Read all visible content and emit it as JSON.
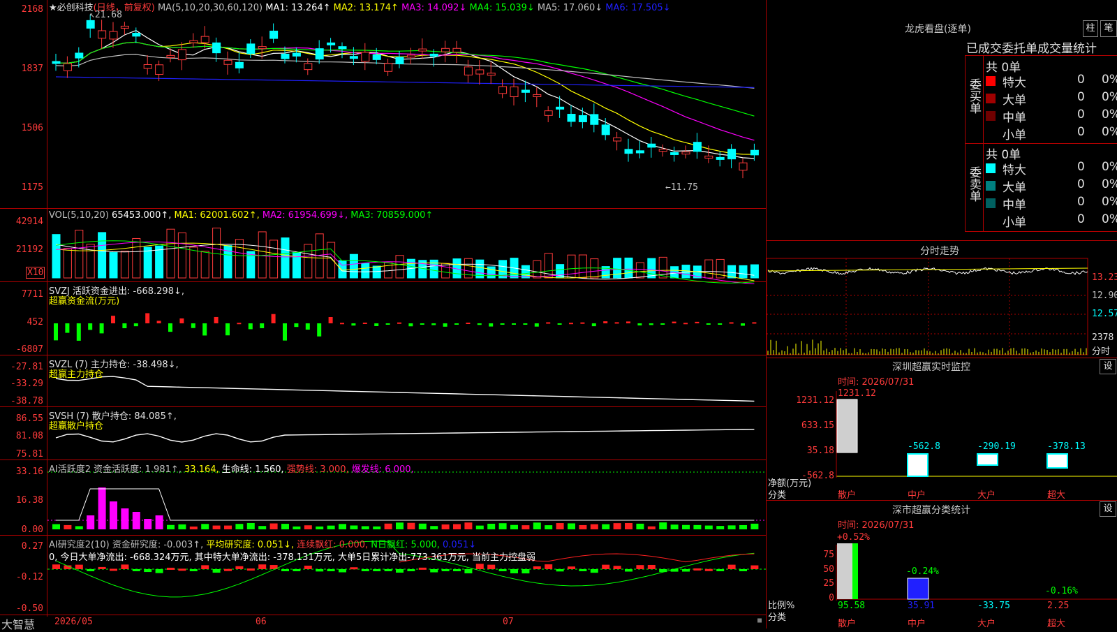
{
  "stock": {
    "title": "★必创科技",
    "period": "(日线，前复权)"
  },
  "kline": {
    "ma_header": [
      {
        "label": "MA(5,10,20,30,60,120)",
        "color": "#c0c0c0"
      },
      {
        "label": "MA1: 13.264↑",
        "color": "#ffffff"
      },
      {
        "label": "MA2: 13.174↑",
        "color": "#ffff00"
      },
      {
        "label": "MA3: 14.092↓",
        "color": "#ff00ff"
      },
      {
        "label": "MA4: 15.039↓",
        "color": "#00ff00"
      },
      {
        "label": "MA5: 17.060↓",
        "color": "#c0c0c0"
      },
      {
        "label": "MA6: 17.505↓",
        "color": "#2020ff"
      }
    ],
    "y_labels": [
      "2168",
      "1837",
      "1506",
      "1175"
    ],
    "high_note": "21.68",
    "low_note": "←11.75"
  },
  "volume": {
    "header": [
      {
        "label": "VOL(5,10,20)",
        "color": "#c0c0c0"
      },
      {
        "label": "65453.000↑,",
        "color": "#ffffff"
      },
      {
        "label": "MA1: 62001.602↑,",
        "color": "#ffff00"
      },
      {
        "label": "MA2: 61954.699↓,",
        "color": "#ff00ff"
      },
      {
        "label": "MA3: 70859.000↑",
        "color": "#00ff00"
      }
    ],
    "y_labels": [
      "42914",
      "21192"
    ],
    "unit": "X10"
  },
  "svzj": {
    "header": "SVZJ  活跃资金进出: -668.298↓,",
    "subtitle": "超赢资金流(万元)",
    "y_labels": [
      "7711",
      "452",
      "-6807"
    ]
  },
  "svzl": {
    "header": "SVZL (7) 主力持仓: -38.498↓,",
    "subtitle": "超赢主力持仓",
    "y_labels": [
      "-27.81",
      "-33.29",
      "-38.78"
    ]
  },
  "svsh": {
    "header": "SVSH (7) 散户持仓: 84.085↑,",
    "subtitle": "超赢散户持仓",
    "y_labels": [
      "86.55",
      "81.08",
      "75.81"
    ]
  },
  "ai_active": {
    "header": [
      {
        "label": "AI活跃度2 资金活跃度: 1.981↑,",
        "color": "#c0c0c0"
      },
      {
        "label": "33.164,",
        "color": "#ffff00"
      },
      {
        "label": "生命线: 1.560,",
        "color": "#ffffff"
      },
      {
        "label": "强势线: 3.000,",
        "color": "#ff3b3b"
      },
      {
        "label": "爆发线: 6.000,",
        "color": "#ff00ff"
      }
    ],
    "y_labels": [
      "33.16",
      "16.38",
      "0.00"
    ]
  },
  "ai_research": {
    "header": [
      {
        "label": "AI研究度2(10) 资金研究度: -0.003↑,",
        "color": "#c0c0c0"
      },
      {
        "label": "平均研究度: 0.051↓,",
        "color": "#ffff00"
      },
      {
        "label": "连续飘红: 0.000,",
        "color": "#ff3b3b"
      },
      {
        "label": "N日飘红: 5.000,",
        "color": "#00ff00"
      },
      {
        "label": "0.051↓",
        "color": "#2020ff"
      }
    ],
    "summary": "0, 今日大单净流出: -668.324万元, 其中特大单净流出: -378.131万元, 大单5日累计净出-773.361万元, 当前主力控盘弱",
    "y_labels": [
      "0.27",
      "-0.12",
      "-0.50"
    ]
  },
  "bottom_bar": {
    "brand": "大智慧",
    "dates": [
      "2026/05",
      "06",
      "07"
    ]
  },
  "longhu": {
    "title": "龙虎看盘(逐单)",
    "btn_bar": "柱",
    "btn_brush": "笔",
    "subtitle": "已成交委托单成交量统计",
    "buy": {
      "side": "委买单",
      "total": "共 0单",
      "rows": [
        {
          "label": "特大",
          "count": "0",
          "pct": "0%",
          "color": "#ff0000"
        },
        {
          "label": "大单",
          "count": "0",
          "pct": "0%",
          "color": "#a00000"
        },
        {
          "label": "中单",
          "count": "0",
          "pct": "0%",
          "color": "#700000"
        },
        {
          "label": "小单",
          "count": "0",
          "pct": "0%",
          "color": ""
        }
      ]
    },
    "sell": {
      "side": "委卖单",
      "total": "共 0单",
      "rows": [
        {
          "label": "特大",
          "count": "0",
          "pct": "0%",
          "color": "#00ffff"
        },
        {
          "label": "大单",
          "count": "0",
          "pct": "0%",
          "color": "#008080"
        },
        {
          "label": "中单",
          "count": "0",
          "pct": "0%",
          "color": "#006060"
        },
        {
          "label": "小单",
          "count": "0",
          "pct": "0%",
          "color": ""
        }
      ]
    }
  },
  "fenshi": {
    "title": "分时走势",
    "prices": [
      "13.23",
      "12.90",
      "12.57"
    ],
    "volume_label": "2378",
    "unit_label": "分时"
  },
  "realtime": {
    "title": "深圳超赢实时监控",
    "setting": "设",
    "time": "时间: 2026/07/31",
    "y_labels": [
      "1231.12",
      "633.15",
      "35.18",
      "-562.8"
    ],
    "axis_label": "净额(万元)",
    "category_label": "分类",
    "bars": [
      {
        "name": "散户",
        "value": "1231.12"
      },
      {
        "name": "中户",
        "value": "-562.8"
      },
      {
        "name": "大户",
        "value": "-290.19"
      },
      {
        "name": "超大",
        "value": "-378.13"
      }
    ]
  },
  "classify": {
    "title": "深市超赢分类统计",
    "setting": "设",
    "time": "时间: 2026/07/31",
    "y_labels": [
      "75",
      "50",
      "25",
      "0"
    ],
    "axis_label": "比例%",
    "category_label": "分类",
    "annotations": [
      "+0.52%",
      "-0.24%",
      "-0.16%"
    ],
    "bars": [
      {
        "name": "散户",
        "value": "95.58"
      },
      {
        "name": "中户",
        "value": "35.91"
      },
      {
        "name": "大户",
        "value": "-33.75"
      },
      {
        "name": "超大",
        "value": "2.25"
      }
    ]
  }
}
